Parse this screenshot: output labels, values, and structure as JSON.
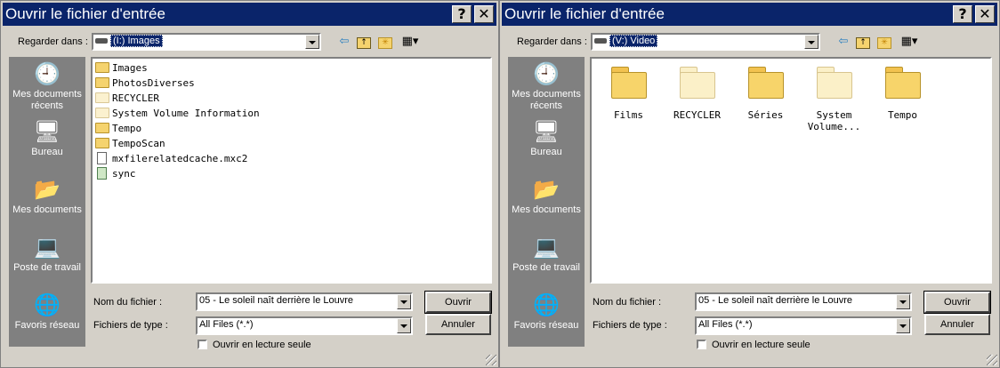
{
  "dialogs": [
    {
      "title": "Ouvrir le fichier d'entrée",
      "help_label": "?",
      "close_label": "✕",
      "look_in_label": "Regarder dans :",
      "look_in_value": "(I:) Images",
      "places": [
        "Mes documents récents",
        "Bureau",
        "Mes documents",
        "Poste de travail",
        "Favoris réseau"
      ],
      "files": [
        {
          "name": "Images",
          "icon": "folder-icon"
        },
        {
          "name": "PhotosDiverses",
          "icon": "folder-icon"
        },
        {
          "name": "RECYCLER",
          "icon": "folder-icon"
        },
        {
          "name": "System Volume Information",
          "icon": "folder-icon"
        },
        {
          "name": "Tempo",
          "icon": "folder-icon"
        },
        {
          "name": "TempoScan",
          "icon": "folder-icon"
        },
        {
          "name": "mxfilerelatedcache.mxc2",
          "icon": "file-icon"
        },
        {
          "name": "sync",
          "icon": "sync-file-icon"
        }
      ],
      "filename_label": "Nom du fichier :",
      "filename_value": "05 - Le soleil naît derrière le Louvre",
      "filetype_label": "Fichiers de type :",
      "filetype_value": "All Files (*.*)",
      "open_label": "Ouvrir",
      "cancel_label": "Annuler",
      "readonly_label": "Ouvrir en lecture seule"
    },
    {
      "title": "Ouvrir le fichier d'entrée",
      "help_label": "?",
      "close_label": "✕",
      "look_in_label": "Regarder dans :",
      "look_in_value": "(V:) Video",
      "places": [
        "Mes documents récents",
        "Bureau",
        "Mes documents",
        "Poste de travail",
        "Favoris réseau"
      ],
      "files": [
        {
          "name": "Films",
          "icon": "folder-icon"
        },
        {
          "name": "RECYCLER",
          "icon": "folder-icon"
        },
        {
          "name": "Séries",
          "icon": "folder-icon"
        },
        {
          "name": "System Volume...",
          "icon": "folder-icon"
        },
        {
          "name": "Tempo",
          "icon": "folder-icon"
        }
      ],
      "filename_label": "Nom du fichier :",
      "filename_value": "05 - Le soleil naît derrière le Louvre",
      "filetype_label": "Fichiers de type :",
      "filetype_value": "All Files (*.*)",
      "open_label": "Ouvrir",
      "cancel_label": "Annuler",
      "readonly_label": "Ouvrir en lecture seule"
    }
  ],
  "colors": {
    "title_bar": "#0a246a",
    "dialog_face": "#d4d0c8",
    "places_bar": "#808080"
  }
}
